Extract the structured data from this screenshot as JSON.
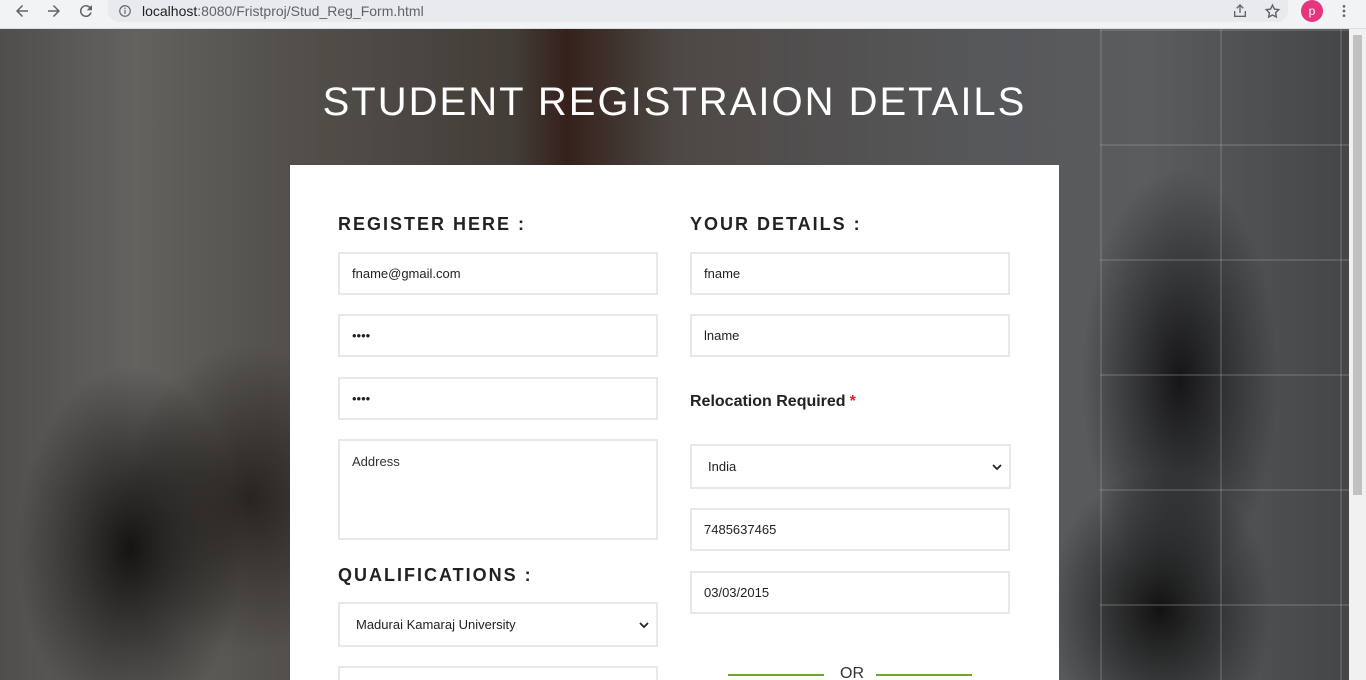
{
  "browser": {
    "url_host": "localhost",
    "url_path": ":8080/Fristproj/Stud_Reg_Form.html",
    "profile_initial": "p"
  },
  "page": {
    "title": "STUDENT REGISTRAION DETAILS"
  },
  "left_column": {
    "heading": "REGISTER HERE :",
    "email_value": "fname@gmail.com",
    "password_value": "••••",
    "confirm_password_value": "••••",
    "address_placeholder": "Address",
    "qualifications_heading": "QUALIFICATIONS :",
    "university_selected": "Madurai Kamaraj University"
  },
  "right_column": {
    "heading": "YOUR DETAILS :",
    "first_name_value": "fname",
    "last_name_value": "lname",
    "relocation_label": "Relocation Required",
    "relocation_required_mark": "*",
    "country_selected": "India",
    "phone_value": "7485637465",
    "date_value": "03/03/2015",
    "divider_text": "OR"
  },
  "colors": {
    "accent_green": "#6aa82a",
    "required_red": "#e02424",
    "avatar_pink": "#e5357d"
  }
}
